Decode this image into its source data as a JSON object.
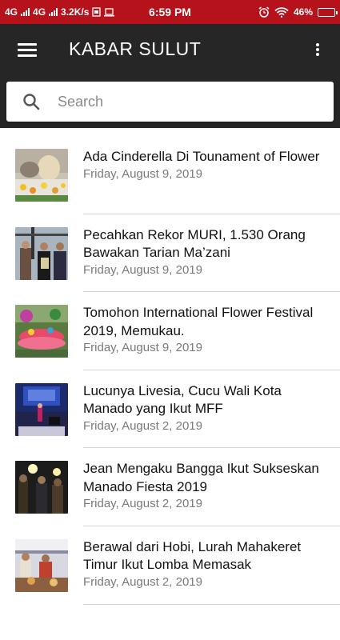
{
  "status_bar": {
    "network1": "4G",
    "network2": "4G",
    "speed": "3.2K/s",
    "time": "6:59 PM",
    "battery": "46%",
    "battery_level": 0.46
  },
  "app_bar": {
    "title": "KABAR SULUT"
  },
  "search": {
    "placeholder": "Search"
  },
  "articles": [
    {
      "title": "Ada Cinderella Di Tounament of Flower",
      "date": "Friday, August 9, 2019",
      "thumb": "flower-float"
    },
    {
      "title": "Pecahkan Rekor MURI, 1.530 Orang Bawakan Tarian Ma’zani",
      "date": "Friday, August 9, 2019",
      "thumb": "award-ceremony"
    },
    {
      "title": "Tomohon International Flower Festival 2019, Memukau.",
      "date": "Friday, August 9, 2019",
      "thumb": "flower-parade"
    },
    {
      "title": "Lucunya Livesia, Cucu Wali Kota Manado yang Ikut MFF",
      "date": "Friday, August 2, 2019",
      "thumb": "stage-show"
    },
    {
      "title": "Jean Mengaku Bangga Ikut Sukseskan Manado Fiesta 2019",
      "date": "Friday, August 2, 2019",
      "thumb": "night-crowd"
    },
    {
      "title": "Berawal dari Hobi, Lurah Mahakeret Timur Ikut Lomba Memasak",
      "date": "Friday, August 2, 2019",
      "thumb": "cooking-contest"
    }
  ],
  "colors": {
    "status_bar": "#b5121b",
    "app_bar": "#262626"
  }
}
